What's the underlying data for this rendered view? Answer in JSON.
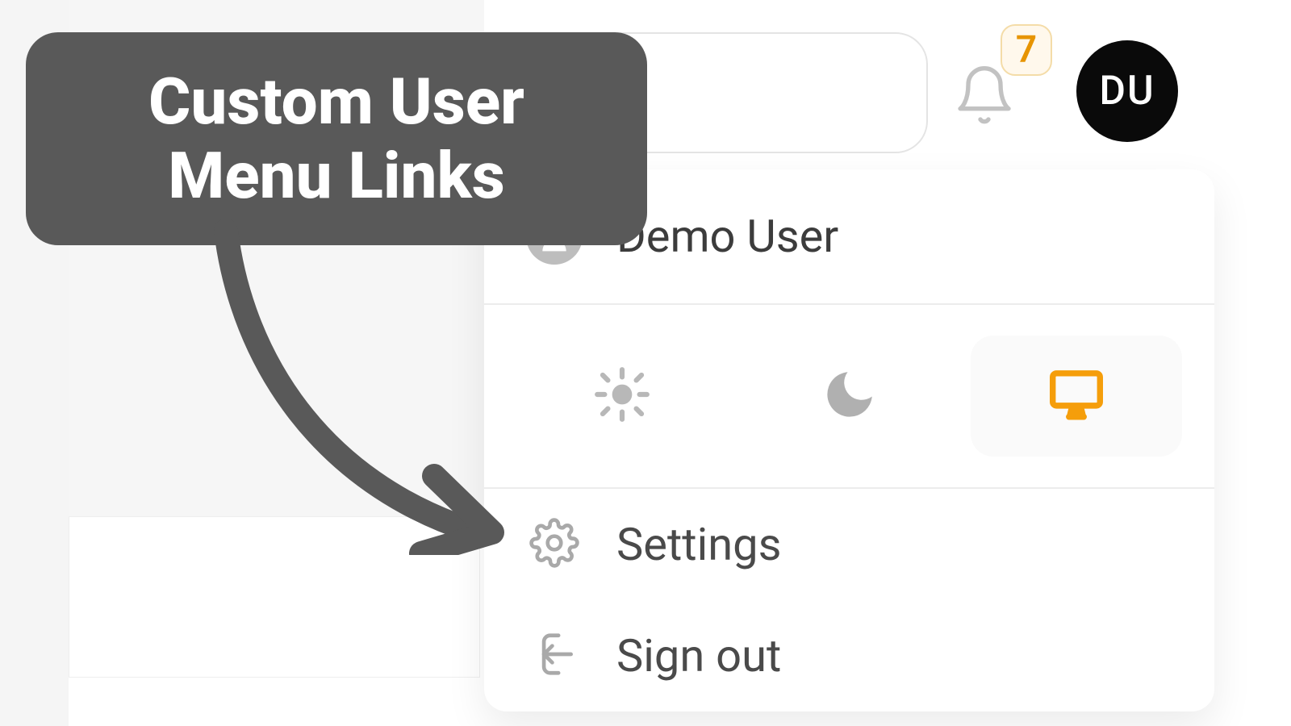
{
  "callout": {
    "text": "Custom User Menu Links"
  },
  "notifications": {
    "count": "7"
  },
  "avatar": {
    "initials": "DU"
  },
  "menu": {
    "user_name": "Demo User",
    "theme_options": {
      "light": "light",
      "dark": "dark",
      "system": "system",
      "selected": "system"
    },
    "items": {
      "settings": "Settings",
      "signout": "Sign out"
    }
  },
  "colors": {
    "accent": "#f59e0b",
    "muted": "#9ca3af",
    "callout_bg": "#595959"
  }
}
